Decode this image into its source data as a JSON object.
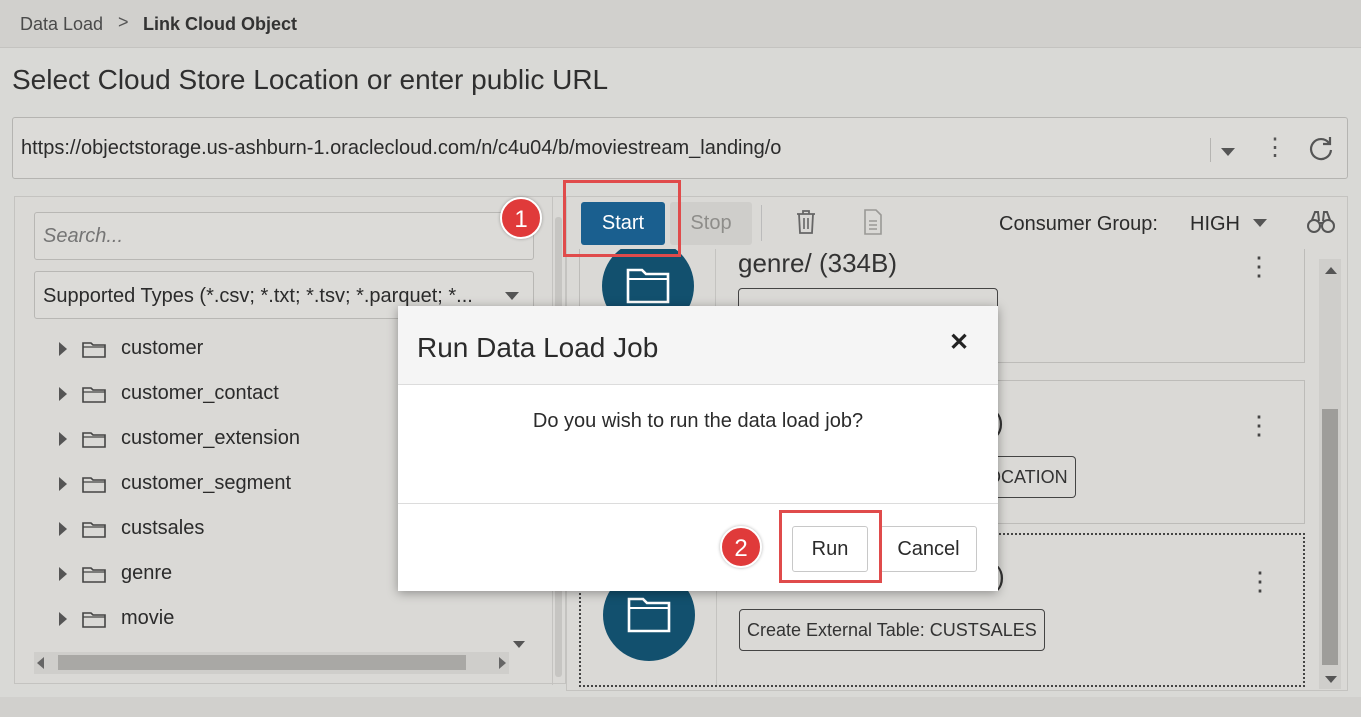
{
  "breadcrumb": {
    "parent": "Data Load",
    "separator": ">",
    "current": "Link Cloud Object"
  },
  "page_title": "Select Cloud Store Location or enter public URL",
  "url_field": {
    "value": "https://objectstorage.us-ashburn-1.oraclecloud.com/n/c4u04/b/moviestream_landing/o"
  },
  "left_panel": {
    "search_placeholder": "Search...",
    "types_filter": "Supported Types (*.csv; *.txt; *.tsv; *.parquet; *...",
    "folders": [
      "customer",
      "customer_contact",
      "customer_extension",
      "customer_segment",
      "custsales",
      "genre",
      "movie"
    ]
  },
  "toolbar": {
    "start_label": "Start",
    "stop_label": "Stop",
    "consumer_group_label": "Consumer Group:",
    "consumer_group_value": "HIGH"
  },
  "cards": [
    {
      "title": "genre/ (334B)",
      "tag": ""
    },
    {
      "title": ")",
      "tag": "OCATION"
    },
    {
      "title": ")",
      "tag": "Create External Table: CUSTSALES"
    }
  ],
  "modal": {
    "title": "Run Data Load Job",
    "close_glyph": "✕",
    "message": "Do you wish to run the data load job?",
    "run_label": "Run",
    "cancel_label": "Cancel"
  },
  "callouts": {
    "step1": "1",
    "step2": "2"
  },
  "colors": {
    "primary": "#1a5f8f",
    "callout": "#e03a3a",
    "card_circle": "#12506e"
  }
}
